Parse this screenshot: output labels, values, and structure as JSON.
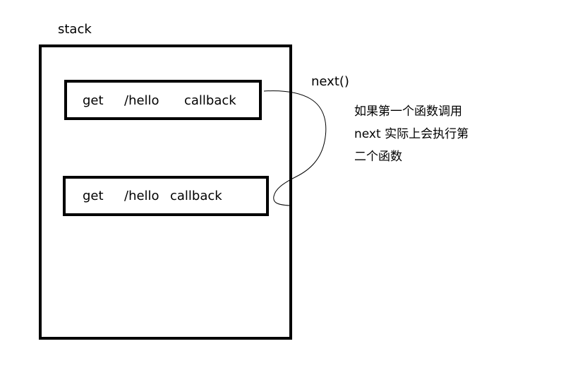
{
  "stack": {
    "title": "stack",
    "layers": [
      {
        "method": "get",
        "path": "/hello",
        "handler": "callback"
      },
      {
        "method": "get",
        "path": "/hello",
        "handler": "callback"
      }
    ]
  },
  "arrow": {
    "label": "next()"
  },
  "note": {
    "lines": [
      "如果第一个函数调用",
      "next 实际上会执行第",
      "二个函数"
    ]
  }
}
